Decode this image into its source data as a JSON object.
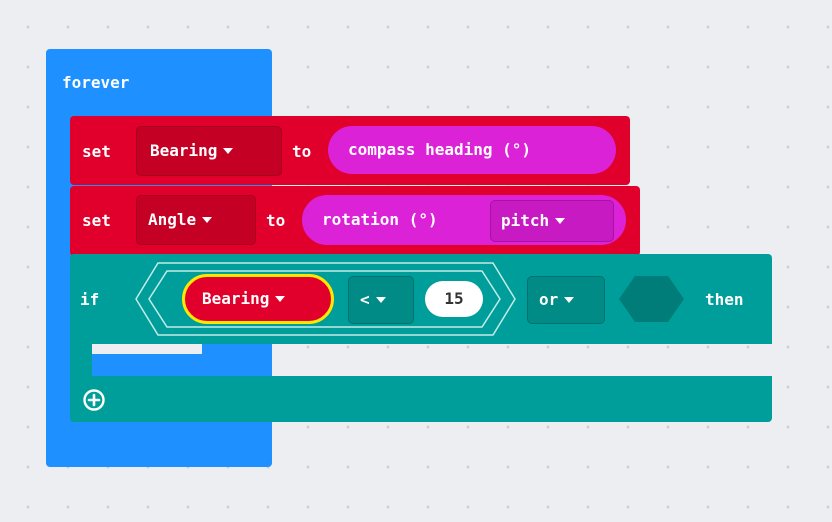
{
  "forever": {
    "label": "forever"
  },
  "set_bearing": {
    "keyword": "set",
    "variable": "Bearing",
    "to": "to",
    "value": "compass heading (°)"
  },
  "set_angle": {
    "keyword": "set",
    "variable": "Angle",
    "to": "to",
    "value": "rotation (°)",
    "axis": "pitch"
  },
  "if_block": {
    "keyword": "if",
    "variable": "Bearing",
    "operator": "<",
    "number": "15",
    "logic": "or",
    "then": "then"
  },
  "colors": {
    "forever": "#1e90ff",
    "set": "#e0002b",
    "input": "#dc22d6",
    "logic": "#009e9a",
    "highlight": "#ffe800"
  },
  "icons": {
    "add": "plus-circle-icon",
    "dropdown": "caret-down-icon"
  }
}
